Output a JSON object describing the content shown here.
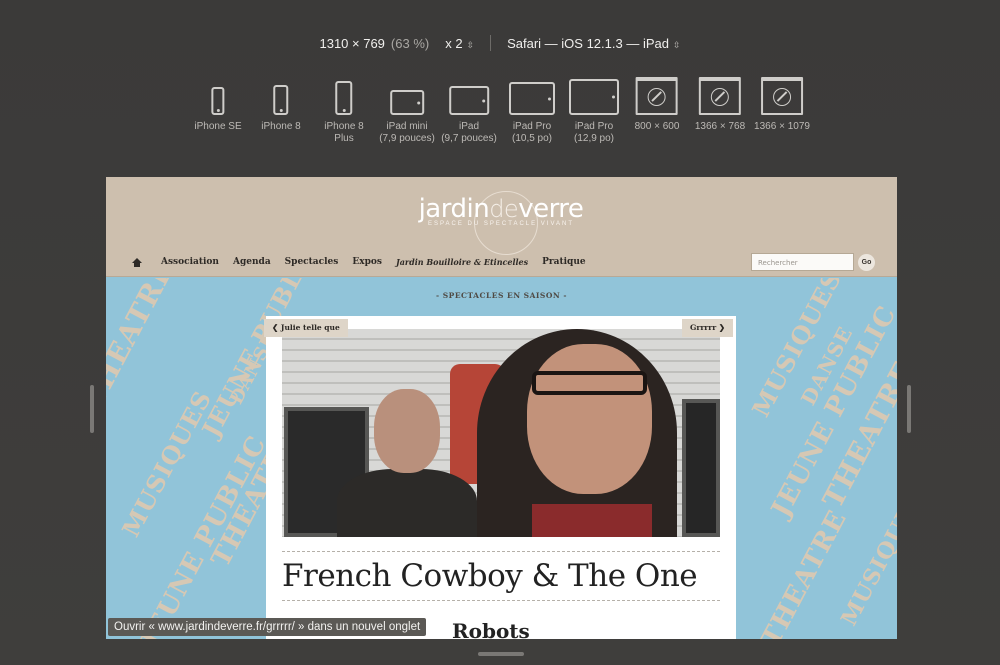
{
  "toolbar": {
    "dimensions": "1310 × 769",
    "zoom_percent": "(63 %)",
    "scale": "x 2",
    "browser": "Safari — iOS 12.1.3 — iPad"
  },
  "devices": [
    {
      "name": "iPhone SE",
      "line2": ""
    },
    {
      "name": "iPhone 8",
      "line2": ""
    },
    {
      "name": "iPhone 8",
      "line2": "Plus"
    },
    {
      "name": "iPad mini",
      "line2": "(7,9 pouces)"
    },
    {
      "name": "iPad",
      "line2": "(9,7 pouces)"
    },
    {
      "name": "iPad Pro",
      "line2": "(10,5 po)"
    },
    {
      "name": "iPad Pro",
      "line2": "(12,9 po)"
    },
    {
      "name": "800 × 600",
      "line2": ""
    },
    {
      "name": "1366 × 768",
      "line2": ""
    },
    {
      "name": "1366 × 1079",
      "line2": ""
    }
  ],
  "site": {
    "logo_a": "jardin",
    "logo_b": "de",
    "logo_c": "verre",
    "logo_sub": "ESPACE DU SPECTACLE VIVANT",
    "nav": [
      "Association",
      "Agenda",
      "Spectacles",
      "Expos",
      "Jardin Bouilloire & Etincelles",
      "Pratique"
    ],
    "search_placeholder": "Rechercher",
    "go_label": "Go",
    "section_label": "- SPECTACLES EN SAISON -",
    "prev_label": "Julie telle que",
    "next_label": "Grrrrr",
    "title": "French Cowboy & The One",
    "subtitle": "Robots",
    "pattern_words": [
      "THEATRE",
      "DANSE",
      "MUSIQUES",
      "JEUNE PUBLIC"
    ]
  },
  "status_tooltip": "Ouvrir « www.jardindeverre.fr/grrrrr/ » dans un nouvel onglet"
}
